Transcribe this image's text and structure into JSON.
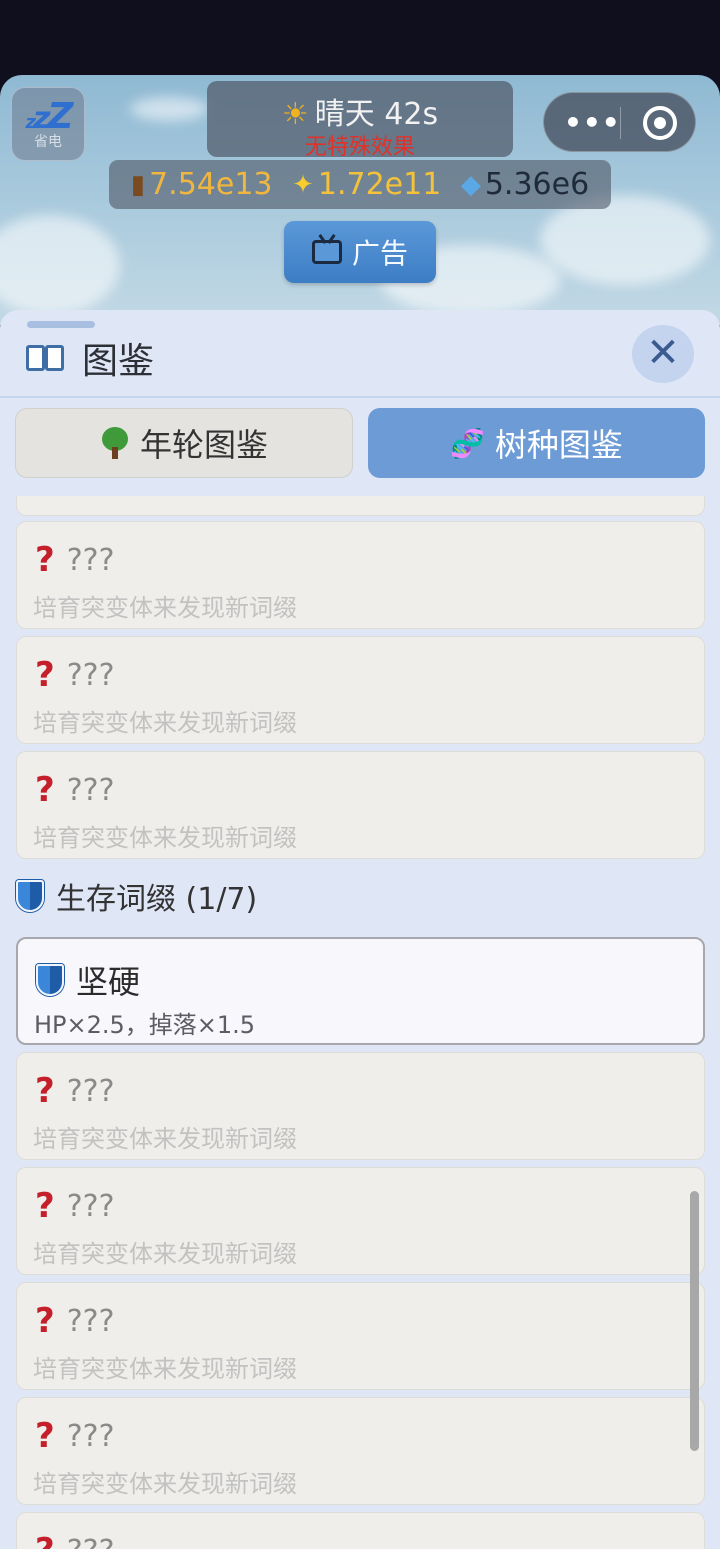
{
  "sleep_button": {
    "label": "省电",
    "icon": "zzz-icon"
  },
  "weather": {
    "name": "晴天 42s",
    "effect": "无特殊效果"
  },
  "resources": {
    "wood": "7.54e13",
    "sparkle": "1.72e11",
    "gem": "5.36e6"
  },
  "ad_button": {
    "label": "广告"
  },
  "sheet": {
    "title": "图鉴",
    "tabs": [
      {
        "label": "年轮图鉴"
      },
      {
        "label": "树种图鉴"
      }
    ]
  },
  "top_cards": [
    {
      "name": "???",
      "desc": "培育突变体来发现新词缀"
    },
    {
      "name": "???",
      "desc": "培育突变体来发现新词缀"
    },
    {
      "name": "???",
      "desc": "培育突变体来发现新词缀"
    }
  ],
  "section": {
    "title": "生存词缀 (1/7)"
  },
  "found_card": {
    "name": "坚硬",
    "desc": "HP×2.5，掉落×1.5"
  },
  "bottom_cards": [
    {
      "name": "???",
      "desc": "培育突变体来发现新词缀"
    },
    {
      "name": "???",
      "desc": "培育突变体来发现新词缀"
    },
    {
      "name": "???",
      "desc": "培育突变体来发现新词缀"
    },
    {
      "name": "???",
      "desc": "培育突变体来发现新词缀"
    },
    {
      "name": "???"
    }
  ],
  "colors": {
    "accent": "#6c9bd6",
    "question": "#c41f2a",
    "shield": "#3a86d9"
  }
}
